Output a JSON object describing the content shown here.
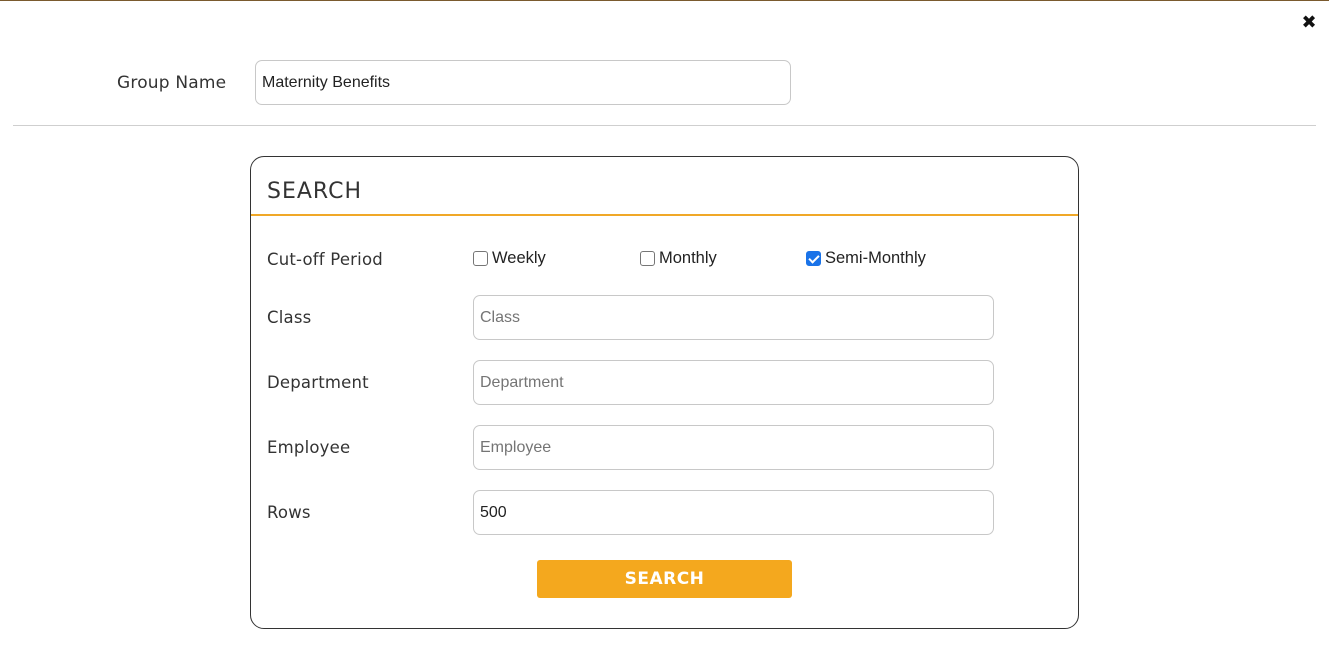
{
  "dialog": {
    "close_icon": "close-icon",
    "close_glyph": "✖"
  },
  "group": {
    "label": "Group Name",
    "value": "Maternity Benefits"
  },
  "search_panel": {
    "title": "SEARCH",
    "accent_color": "#f0a828",
    "cutoff": {
      "label": "Cut-off Period",
      "options": [
        {
          "label": "Weekly",
          "checked": false
        },
        {
          "label": "Monthly",
          "checked": false
        },
        {
          "label": "Semi-Monthly",
          "checked": true
        }
      ]
    },
    "class": {
      "label": "Class",
      "placeholder": "Class",
      "value": ""
    },
    "department": {
      "label": "Department",
      "placeholder": "Department",
      "value": ""
    },
    "employee": {
      "label": "Employee",
      "placeholder": "Employee",
      "value": ""
    },
    "rows": {
      "label": "Rows",
      "value": "500"
    },
    "button_label": "SEARCH",
    "button_color": "#f4a81e"
  }
}
